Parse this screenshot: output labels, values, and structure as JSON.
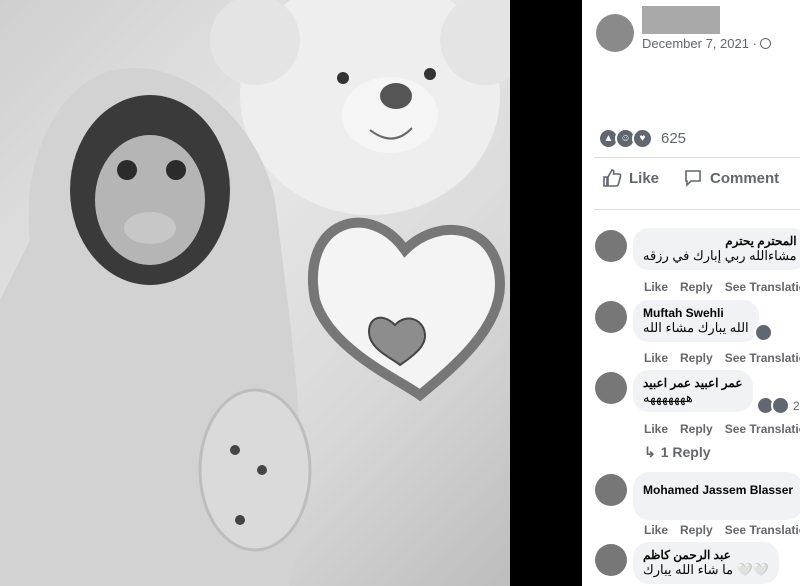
{
  "post": {
    "date": "December 7, 2021 ·",
    "reaction_count": "625",
    "actions": {
      "like": "Like",
      "comment": "Comment"
    }
  },
  "comments": [
    {
      "name": "المحترم يحترم",
      "text": "مشاءالله ربي إبارك في رزقه",
      "actions": [
        "Like",
        "Reply",
        "See Translation"
      ]
    },
    {
      "name": "Muftah Swehli",
      "text": "الله يبارك مشاء الله",
      "actions": [
        "Like",
        "Reply",
        "See Translation"
      ]
    },
    {
      "name": "عمر اعبيد عمر اعبيد",
      "text": "هههههههه",
      "reaction_count": "2",
      "actions": [
        "Like",
        "Reply",
        "See Translation"
      ]
    },
    {
      "name": "Mohamed Jassem Blasser",
      "text": "",
      "actions": [
        "Like",
        "Reply",
        "See Translation"
      ]
    },
    {
      "name": "عبد الرحمن كاظم",
      "text": "ما شاء الله يبارك 🤍🤍",
      "actions": []
    }
  ],
  "replies_link": "1 Reply",
  "icons": {
    "reactions": [
      "like-reaction-icon",
      "haha-reaction-icon",
      "love-reaction-icon"
    ],
    "like": "thumbs-up-icon",
    "comment": "speech-bubble-icon",
    "privacy": "globe-icon",
    "reply_arrow": "reply-arrow-icon"
  }
}
